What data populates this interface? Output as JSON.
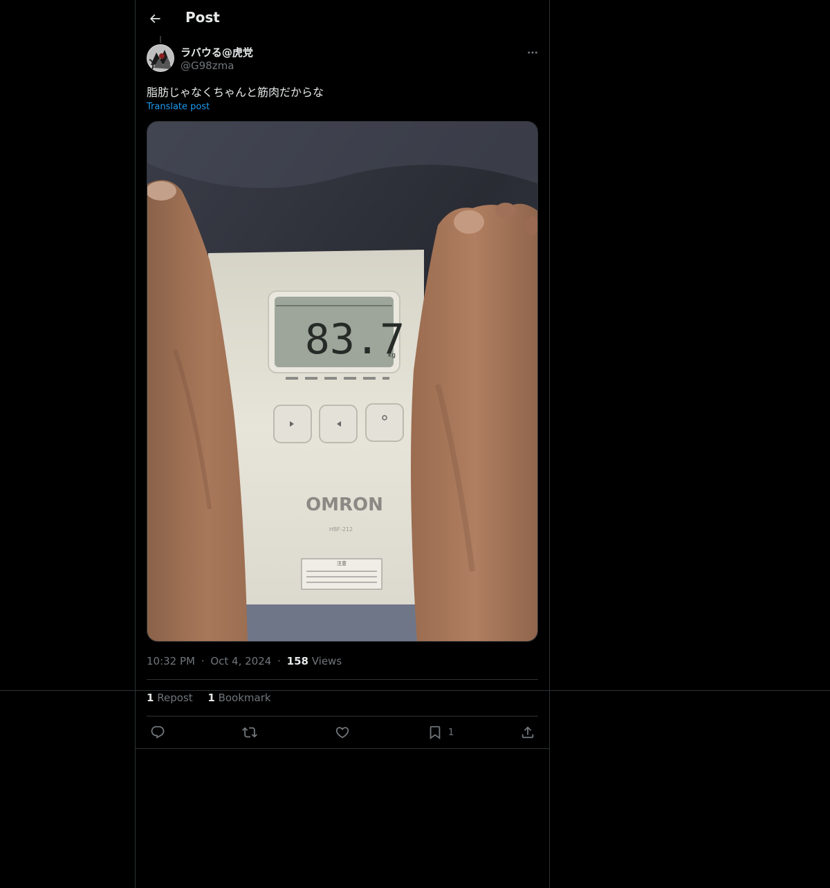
{
  "header": {
    "title": "Post",
    "back_icon": "arrow-left-icon"
  },
  "author": {
    "name": "ラバウる@虎党",
    "handle": "@G98zma",
    "more_icon": "more-horizontal-icon"
  },
  "post": {
    "text": "脂肪じゃなくちゃんと筋肉だからな",
    "translate_label": "Translate post",
    "media": {
      "scale_reading": "83.7",
      "scale_unit": "kg",
      "scale_brand": "OMRON",
      "scale_model": "HBF-212",
      "scale_caution": "注意"
    }
  },
  "meta": {
    "time": "10:32 PM",
    "dot": "·",
    "date": "Oct 4, 2024",
    "views_count": "158",
    "views_label": "Views"
  },
  "stats": {
    "reposts_count": "1",
    "reposts_label": "Repost",
    "bookmarks_count": "1",
    "bookmarks_label": "Bookmark"
  },
  "actions": {
    "reply_icon": "reply-icon",
    "repost_icon": "repost-icon",
    "like_icon": "heart-icon",
    "bookmark_icon": "bookmark-icon",
    "bookmark_count": "1",
    "share_icon": "share-icon"
  },
  "colors": {
    "background": "#000000",
    "border": "#2f3336",
    "text_primary": "#e7e9ea",
    "text_secondary": "#71767b",
    "link": "#1d9bf0"
  }
}
